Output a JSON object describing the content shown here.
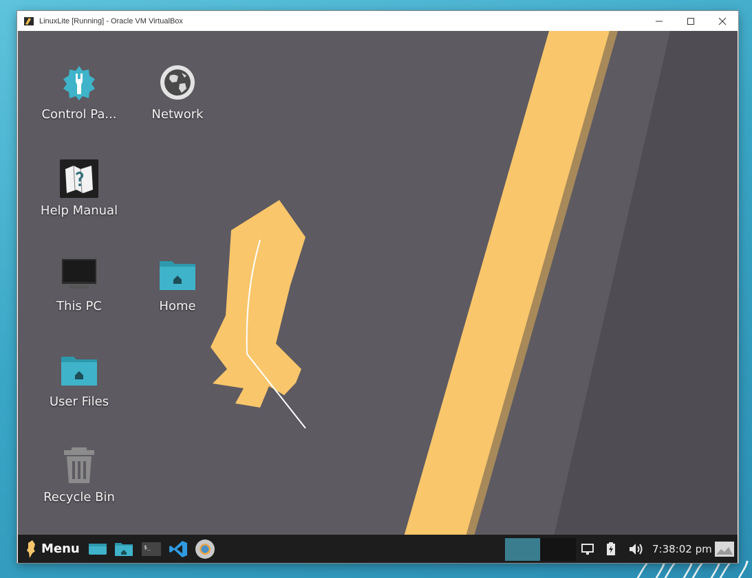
{
  "host": {
    "window_title": "LinuxLite [Running] - Oracle VM VirtualBox",
    "controls": {
      "minimize": "minimize",
      "maximize": "maximize",
      "close": "close"
    }
  },
  "desktop": {
    "icons": [
      {
        "label": "Control Pa...",
        "icon": "gear-wrench-icon"
      },
      {
        "label": "Network",
        "icon": "globe-icon"
      },
      {
        "label": "Help Manual",
        "icon": "help-map-icon"
      },
      {
        "label": "This PC",
        "icon": "monitor-icon"
      },
      {
        "label": "Home",
        "icon": "home-folder-icon"
      },
      {
        "label": "User Files",
        "icon": "user-folder-icon"
      },
      {
        "label": "Recycle Bin",
        "icon": "trash-icon"
      }
    ]
  },
  "taskbar": {
    "menu_label": "Menu",
    "launchers": [
      "desktop-icon",
      "files-icon",
      "terminal-icon",
      "vscode-icon",
      "chrome-icon"
    ],
    "workspaces": 2,
    "tray": [
      "display-icon",
      "battery-icon",
      "volume-icon"
    ],
    "clock": "7:38:02 pm"
  },
  "colors": {
    "desktop_bg": "#5d5a61",
    "accent_yellow": "#f9c66b",
    "folder_teal": "#3fb3c9",
    "taskbar_bg": "#1d1d1e"
  }
}
